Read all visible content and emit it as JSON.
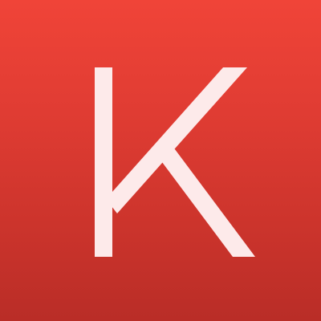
{
  "icon": {
    "letter": "K",
    "name": "k-letter-icon",
    "background_top": "#f04438",
    "background_bottom": "#b92d27",
    "letter_color": "#fdeaea"
  }
}
